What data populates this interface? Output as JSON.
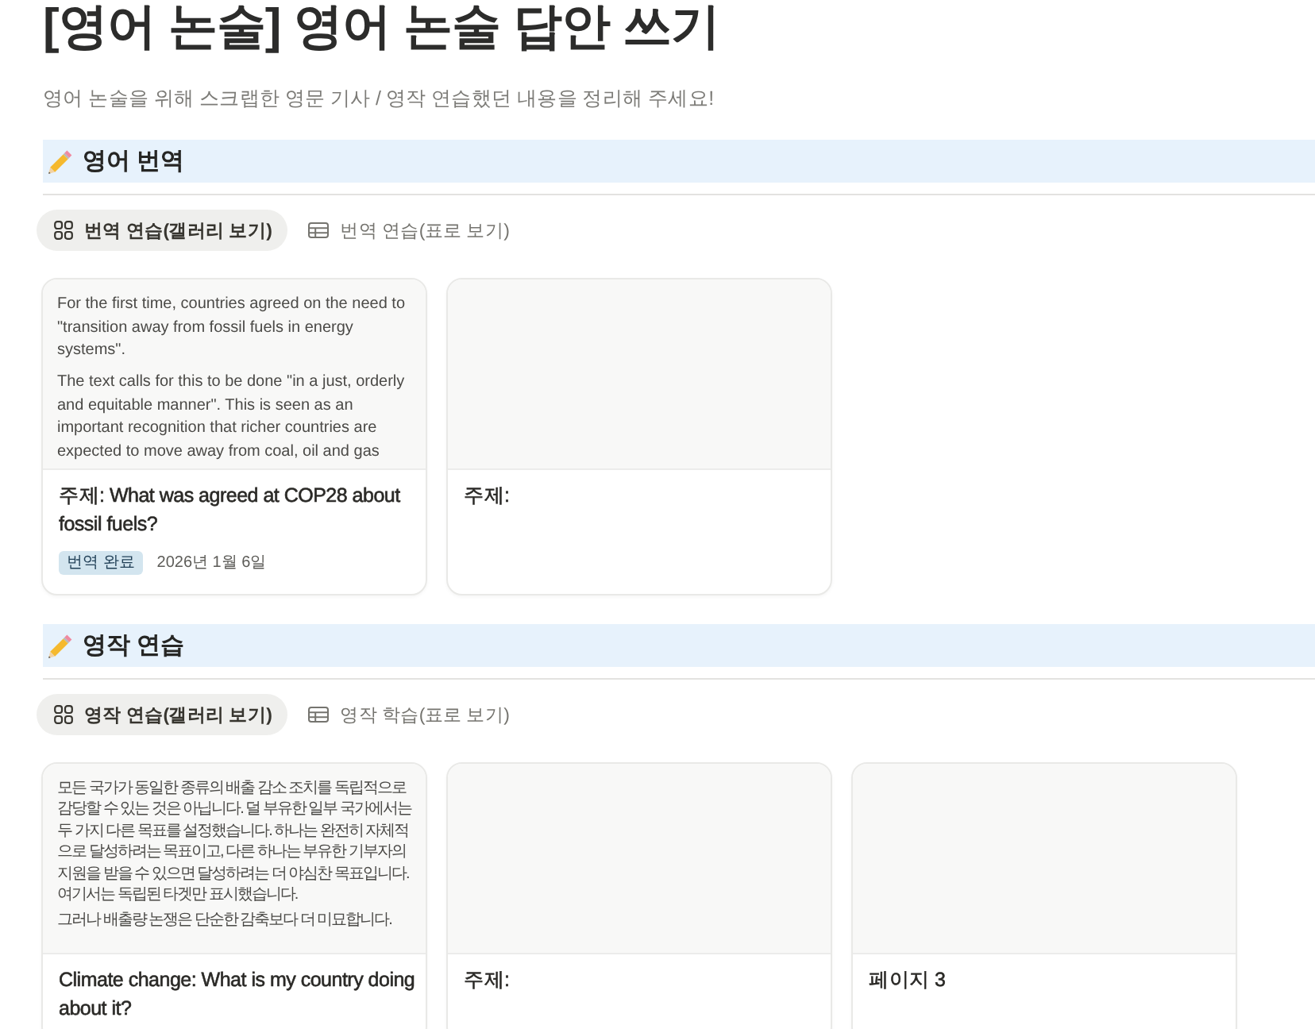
{
  "page": {
    "title": "[영어 논술] 영어 논술 답안 쓰기",
    "description": "영어 논술을 위해 스크랩한 영문 기사 / 영작 연습했던 내용을 정리해 주세요!"
  },
  "sections": [
    {
      "heading": "영어 번역",
      "views": [
        {
          "label": "번역 연습(갤러리 보기)",
          "kind": "gallery",
          "selected": true
        },
        {
          "label": "번역 연습(표로 보기)",
          "kind": "table",
          "selected": false
        }
      ],
      "cards": [
        {
          "preview": [
            "For the first time, countries agreed on the need to \"transition away from fossil fuels in energy systems\".",
            "The text calls for this to be done \"in a just, orderly and equitable manner\". This is seen as an important recognition that richer countries are expected to move away from coal, oil and gas"
          ],
          "title": "주제: What was agreed at COP28 about fossil fuels?",
          "tag": "번역 완료",
          "date": "2026년 1월 6일"
        },
        {
          "title": "주제:"
        }
      ]
    },
    {
      "heading": "영작 연습",
      "views": [
        {
          "label": "영작 연습(갤러리 보기)",
          "kind": "gallery",
          "selected": true
        },
        {
          "label": "영작 학습(표로 보기)",
          "kind": "table",
          "selected": false
        }
      ],
      "cards": [
        {
          "preview": [
            "모든 국가가 동일한 종류의 배출 감소 조치를 독립적으로 감당할 수 있는 것은 아닙니다. 덜 부유한 일부 국가에서는 두 가지 다른 목표를 설정했습니다. 하나는 완전히 자체적으로 달성하려는 목표이고, 다른 하나는 부유한 기부자의 지원을 받을 수 있으면 달성하려는 더 야심찬 목표입니다. 여기서는 독립된 타겟만 표시했습니다.",
            "그러나 배출량 논쟁은 단순한 감축보다 더 미묘합니다."
          ],
          "title": "Climate change: What is my country doing about it?"
        },
        {
          "title": "주제:"
        },
        {
          "title": "페이지 3"
        }
      ]
    }
  ]
}
